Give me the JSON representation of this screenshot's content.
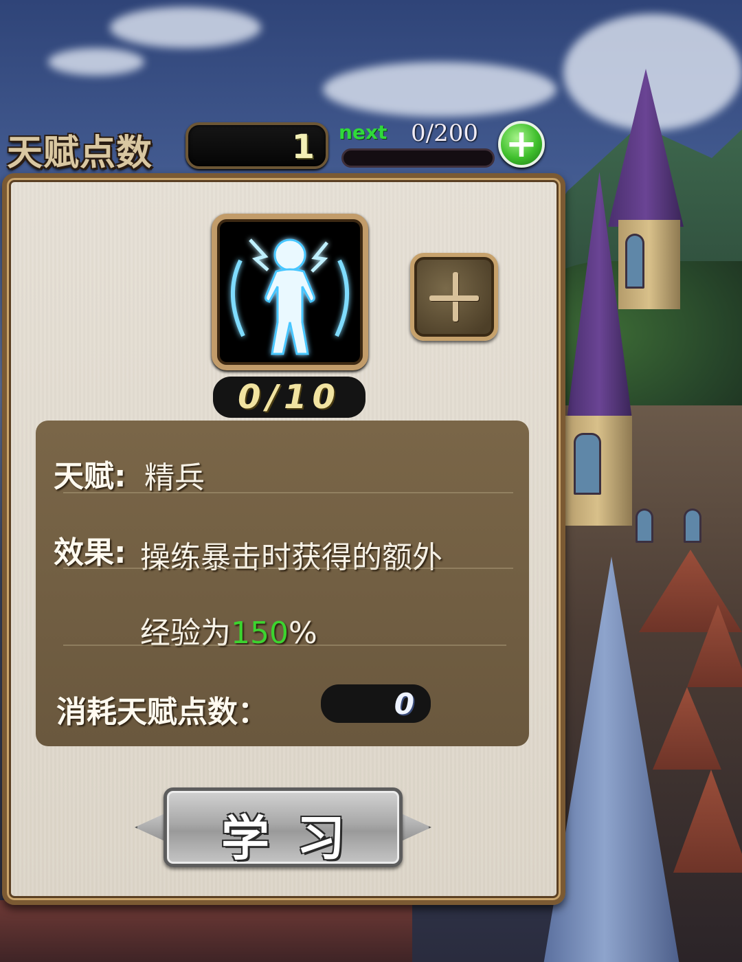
{
  "header": {
    "title": "天赋点数",
    "talent_points": "1",
    "next_label": "next",
    "next_progress": "0/200",
    "next_progress_fraction": 0.0
  },
  "skill": {
    "level": "0/10",
    "icon": "glowing-figure-icon"
  },
  "info": {
    "talent_label": "天赋:",
    "talent_name": "精兵",
    "effect_label": "效果:",
    "effect_line1": "操练暴击时获得的额外",
    "effect_line2_prefix": "经验为",
    "effect_line2_value": "150",
    "effect_line2_suffix": "%",
    "cost_label": "消耗天赋点数：",
    "cost_value": "0"
  },
  "actions": {
    "learn_label": "学习"
  },
  "colors": {
    "highlight_green": "#3cd42f",
    "panel_border": "#7b5a33",
    "info_bg": "#7a6648"
  }
}
